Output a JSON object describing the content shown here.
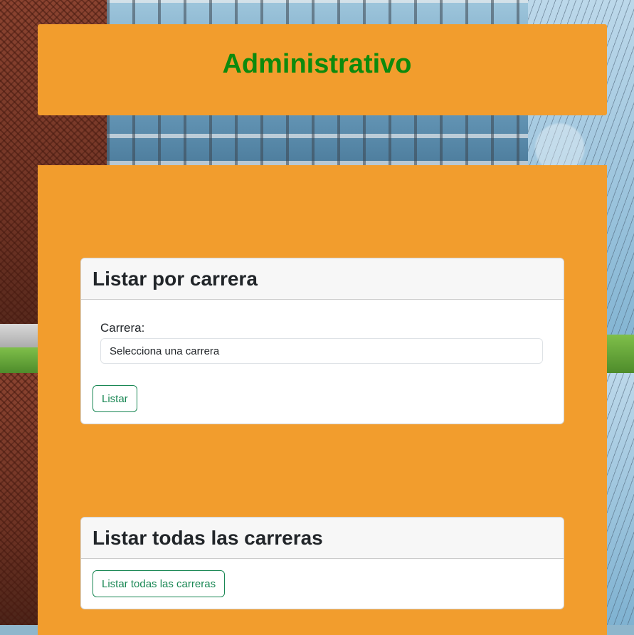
{
  "header": {
    "title": "Administrativo"
  },
  "card_carrera": {
    "title": "Listar por carrera",
    "field_label": "Carrera:",
    "select_value": "Selecciona una carrera",
    "button_label": "Listar"
  },
  "card_todas": {
    "title": "Listar todas las carreras",
    "button_label": "Listar todas las carreras"
  },
  "colors": {
    "panel": "#f29d2d",
    "title": "#0d8a0d",
    "button_outline": "#198754"
  }
}
